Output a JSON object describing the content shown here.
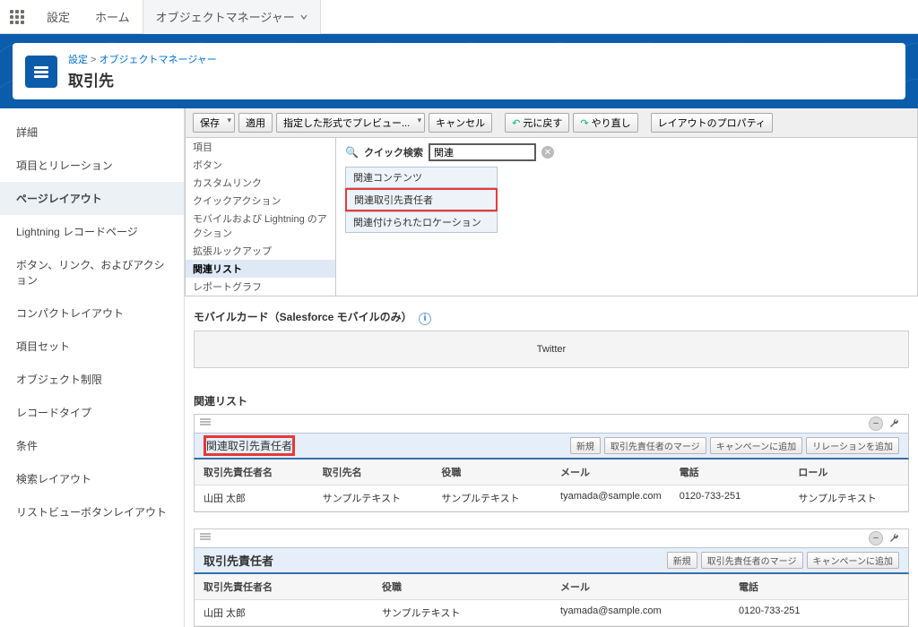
{
  "top": {
    "title": "設定",
    "tabs": [
      {
        "label": "ホーム",
        "active": false
      },
      {
        "label": "オブジェクトマネージャー",
        "active": true,
        "chevron": true
      }
    ]
  },
  "header": {
    "breadcrumb_setup": "設定",
    "breadcrumb_objmgr": "オブジェクトマネージャー",
    "title": "取引先"
  },
  "sidebar": {
    "items": [
      {
        "label": "詳細"
      },
      {
        "label": "項目とリレーション"
      },
      {
        "label": "ページレイアウト",
        "active": true
      },
      {
        "label": "Lightning レコードページ"
      },
      {
        "label": "ボタン、リンク、およびアクション"
      },
      {
        "label": "コンパクトレイアウト"
      },
      {
        "label": "項目セット"
      },
      {
        "label": "オブジェクト制限"
      },
      {
        "label": "レコードタイプ"
      },
      {
        "label": "条件"
      },
      {
        "label": "検索レイアウト"
      },
      {
        "label": "リストビューボタンレイアウト"
      }
    ]
  },
  "toolbar": {
    "save": "保存",
    "apply": "適用",
    "preview": "指定した形式でプレビュー...",
    "cancel": "キャンセル",
    "undo": "元に戻す",
    "redo": "やり直し",
    "layout_props": "レイアウトのプロパティ"
  },
  "palette": {
    "quick_find_label": "クイック検索",
    "quick_find_value": "関連",
    "categories": [
      "項目",
      "ボタン",
      "カスタムリンク",
      "クイックアクション",
      "モバイルおよび Lightning のアクション",
      "拡張ルックアップ",
      "関連リスト",
      "レポートグラフ"
    ],
    "items": [
      {
        "label": "関連コンテンツ"
      },
      {
        "label": "関連取引先責任者",
        "highlight": true
      },
      {
        "label": "関連付けられたロケーション"
      }
    ]
  },
  "mobile_card": {
    "heading": "モバイルカード（Salesforce モバイルのみ）",
    "twitter": "Twitter"
  },
  "related_lists_heading": "関連リスト",
  "rl_actions": {
    "new": "新規",
    "merge_contacts": "取引先責任者のマージ",
    "add_campaign": "キャンペーンに追加",
    "add_relation": "リレーションを追加"
  },
  "rl1": {
    "title": "関連取引先責任者",
    "cols": [
      "取引先責任者名",
      "取引先名",
      "役職",
      "メール",
      "電話",
      "ロール"
    ],
    "row": [
      "山田 太郎",
      "サンプルテキスト",
      "サンプルテキスト",
      "tyamada@sample.com",
      "0120-733-251",
      "サンプルテキスト"
    ]
  },
  "rl2": {
    "title": "取引先責任者",
    "cols": [
      "取引先責任者名",
      "役職",
      "メール",
      "電話"
    ],
    "row": [
      "山田 太郎",
      "サンプルテキスト",
      "tyamada@sample.com",
      "0120-733-251"
    ]
  }
}
